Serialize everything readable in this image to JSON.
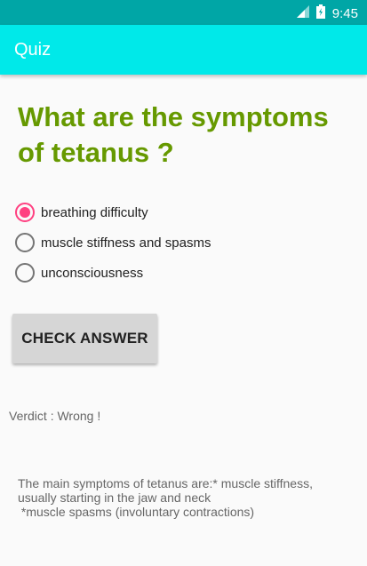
{
  "status_bar": {
    "time": "9:45",
    "icons": [
      "signal-icon",
      "battery-icon"
    ]
  },
  "app_bar": {
    "title": "Quiz"
  },
  "question": {
    "text": "What are the symptoms of tetanus ?"
  },
  "options": [
    {
      "label": "breathing difficulty",
      "checked": true
    },
    {
      "label": "muscle stiffness and spasms",
      "checked": false
    },
    {
      "label": "unconsciousness",
      "checked": false
    }
  ],
  "check_button": {
    "label": "CHECK ANSWER"
  },
  "verdict": {
    "text": "Verdict : Wrong !"
  },
  "explanation": {
    "text": "The main symptoms of tetanus are:* muscle stiffness, usually starting in the jaw and neck\n *muscle spasms (involuntary contractions)"
  },
  "colors": {
    "status_bar": "#00a6a6",
    "app_bar": "#00e9e9",
    "question": "#669900",
    "radio_accent": "#ff4081",
    "button": "#d6d6d6"
  }
}
